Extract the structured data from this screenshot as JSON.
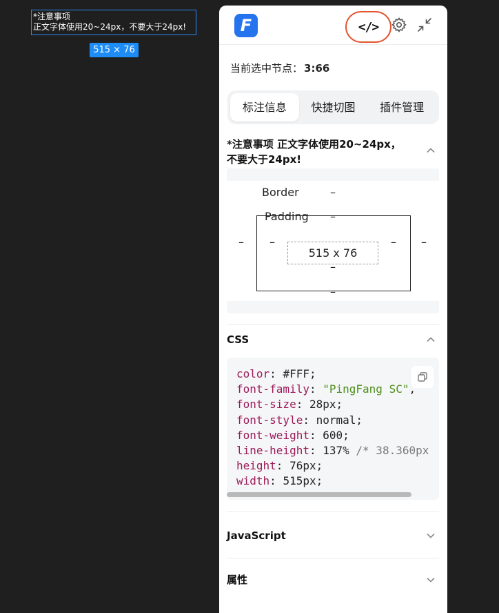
{
  "canvas": {
    "selection_text_line1": "*注意事项",
    "selection_text_line2": "正文字体使用20~24px，不要大于24px!",
    "size_badge": "515 × 76"
  },
  "panel": {
    "logo_letter": "F",
    "code_icon_glyph": "</>",
    "current_node_label": "当前选中节点：",
    "current_node_value": "3:66",
    "tabs": [
      {
        "label": "标注信息",
        "active": true
      },
      {
        "label": "快捷切图",
        "active": false
      },
      {
        "label": "插件管理",
        "active": false
      }
    ],
    "element_title_line1": "*注意事项 正文字体使用20~24px，",
    "element_title_line2": "不要大于24px!",
    "box_model": {
      "border_label": "Border",
      "border_value": "–",
      "padding_label": "Padding",
      "padding_value": "–",
      "content_size": "515 x 76",
      "dash": "–"
    },
    "css_section": {
      "title": "CSS",
      "lines": [
        {
          "prop": "color",
          "value": "#FFF",
          "type": "plain",
          "end": ";"
        },
        {
          "prop": "font-family",
          "value": "\"PingFang SC\"",
          "type": "str",
          "end": ","
        },
        {
          "prop": "font-size",
          "value": "28px",
          "type": "plain",
          "end": ";"
        },
        {
          "prop": "font-style",
          "value": "normal",
          "type": "plain",
          "end": ";"
        },
        {
          "prop": "font-weight",
          "value": "600",
          "type": "plain",
          "end": ";"
        },
        {
          "prop": "line-height",
          "value": "137%",
          "type": "plain",
          "end": " ",
          "comment": "/* 38.360px"
        },
        {
          "prop": "height",
          "value": "76px",
          "type": "plain",
          "end": ";"
        },
        {
          "prop": "width",
          "value": "515px",
          "type": "plain",
          "end": ";"
        }
      ]
    },
    "js_section_title": "JavaScript",
    "attr_section_title": "属性"
  },
  "colors": {
    "accent": "#2673ee",
    "highlight_ring": "#e2542d",
    "canvas_bg": "#1f1f1f",
    "selection": "#2b8cf7",
    "css_prop": "#9c1b5a",
    "css_string": "#4e8f1a"
  },
  "icons": [
    "code-icon",
    "gear-icon",
    "shrink-icon",
    "chevron-up-icon",
    "chevron-down-icon",
    "copy-icon"
  ]
}
